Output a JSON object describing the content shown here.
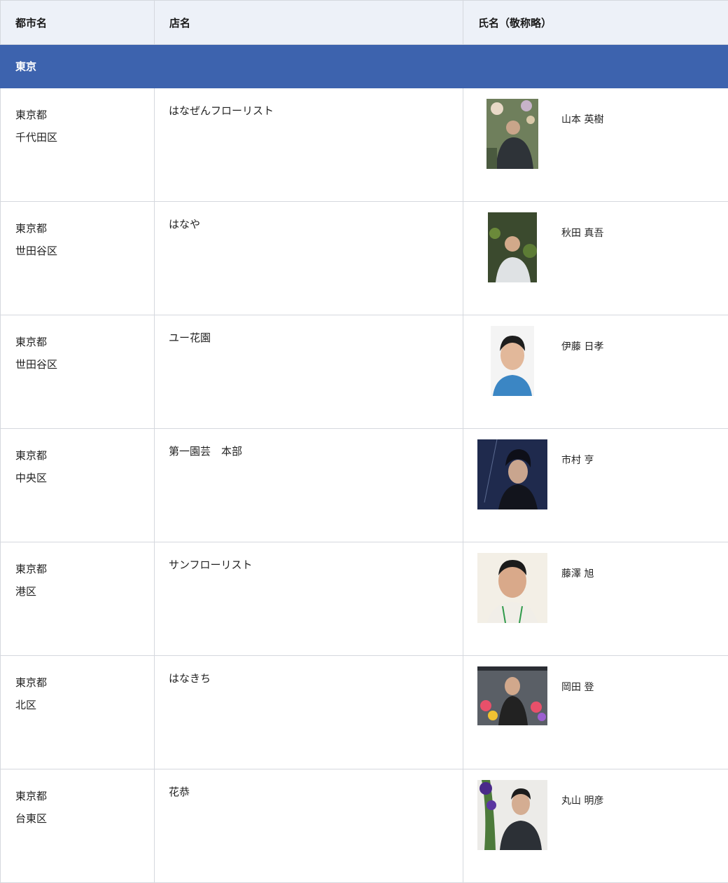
{
  "header": {
    "city_label": "都市名",
    "shop_label": "店名",
    "name_label": "氏名（敬称略）"
  },
  "region": {
    "label": "東京"
  },
  "rows": [
    {
      "pref": "東京都",
      "ward": "千代田区",
      "shop": "はなぜんフローリスト",
      "name": "山本 英樹",
      "photo_icon": "florist-portrait-photo"
    },
    {
      "pref": "東京都",
      "ward": "世田谷区",
      "shop": "はなや",
      "name": "秋田 真吾",
      "photo_icon": "florist-portrait-photo"
    },
    {
      "pref": "東京都",
      "ward": "世田谷区",
      "shop": "ユー花園",
      "name": "伊藤 日孝",
      "photo_icon": "florist-portrait-photo"
    },
    {
      "pref": "東京都",
      "ward": "中央区",
      "shop": "第一園芸　本部",
      "name": "市村 亨",
      "photo_icon": "florist-portrait-photo"
    },
    {
      "pref": "東京都",
      "ward": "港区",
      "shop": "サンフローリスト",
      "name": "藤澤 旭",
      "photo_icon": "florist-portrait-photo"
    },
    {
      "pref": "東京都",
      "ward": "北区",
      "shop": "はなきち",
      "name": "岡田 登",
      "photo_icon": "florist-portrait-photo"
    },
    {
      "pref": "東京都",
      "ward": "台東区",
      "shop": "花恭",
      "name": "丸山 明彦",
      "photo_icon": "florist-portrait-photo"
    }
  ],
  "colors": {
    "header_bg": "#edf1f8",
    "region_bg": "#3d63ae",
    "border": "#d5d8de"
  }
}
